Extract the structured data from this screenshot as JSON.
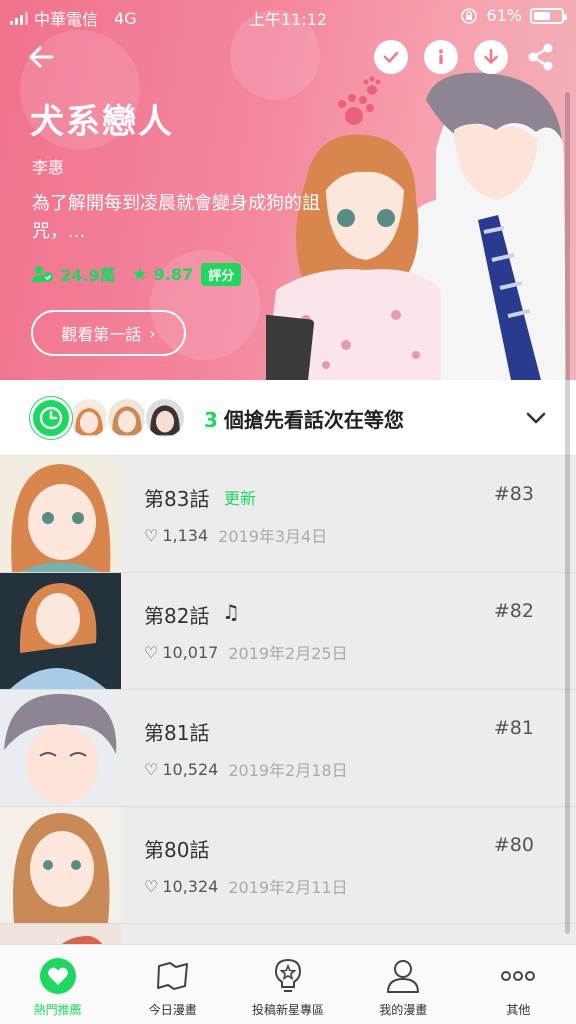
{
  "status_bar": {
    "carrier": "中華電信",
    "network": "4G",
    "time": "上午11:12",
    "battery": "61%",
    "battery_level": 0.61
  },
  "header": {
    "back_icon": "arrow-left-icon",
    "actions": [
      "check-icon",
      "info-icon",
      "download-icon",
      "share-icon"
    ]
  },
  "comic": {
    "title": "犬系戀人",
    "author": "李惠",
    "synopsis": "為了解開每到凌晨就會變身成狗的詛咒，...",
    "subscribers": "24.9萬",
    "rating": "9.87",
    "rate_label": "評分",
    "watch_first": "觀看第一話"
  },
  "preview": {
    "count": "3",
    "text": "個搶先看話次在等您"
  },
  "episodes": [
    {
      "title": "第83話",
      "badge": "更新",
      "number": "#83",
      "likes": "1,134",
      "date": "2019年3月4日"
    },
    {
      "title": "第82話",
      "badge": "♫",
      "number": "#82",
      "likes": "10,017",
      "date": "2019年2月25日"
    },
    {
      "title": "第81話",
      "badge": "",
      "number": "#81",
      "likes": "10,524",
      "date": "2019年2月18日"
    },
    {
      "title": "第80話",
      "badge": "",
      "number": "#80",
      "likes": "10,324",
      "date": "2019年2月11日"
    }
  ],
  "tabs": [
    {
      "label": "熱門推薦",
      "icon": "heart-icon",
      "active": true
    },
    {
      "label": "今日漫畫",
      "icon": "map-icon",
      "active": false
    },
    {
      "label": "投稿新星專區",
      "icon": "bulb-star-icon",
      "active": false
    },
    {
      "label": "我的漫畫",
      "icon": "person-icon",
      "active": false
    },
    {
      "label": "其他",
      "icon": "more-icon",
      "active": false
    }
  ],
  "colors": {
    "accent": "#1ed760",
    "hero_pink": "#f4879e"
  }
}
